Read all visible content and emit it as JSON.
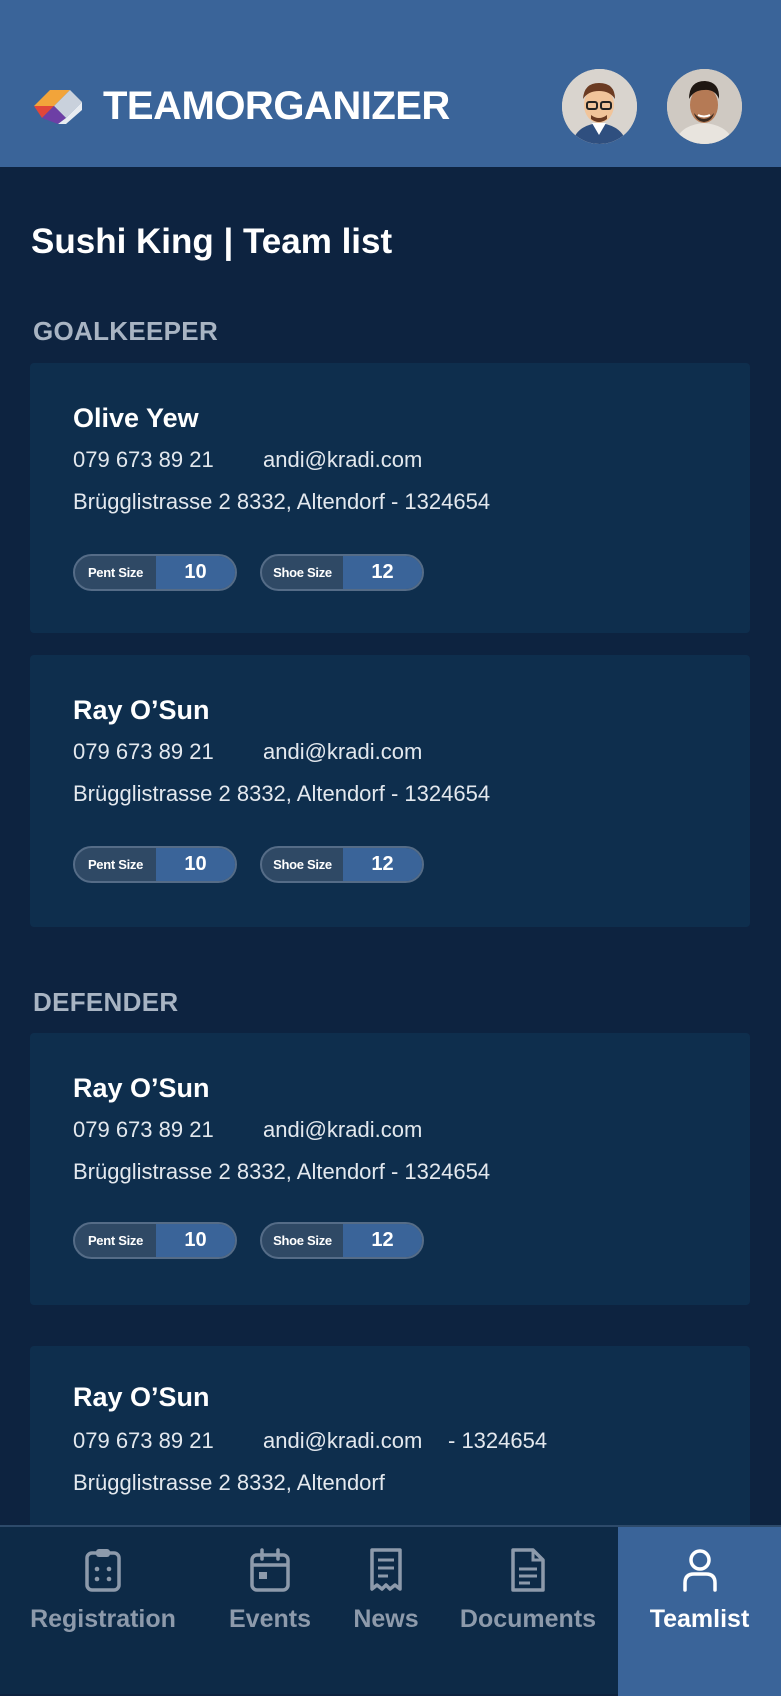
{
  "app": {
    "brand": "TEAMORGANIZER"
  },
  "page": {
    "title": "Sushi King | Team list"
  },
  "sections": [
    {
      "label": "GOALKEEPER"
    },
    {
      "label": "DEFENDER"
    }
  ],
  "players": [
    {
      "name": "Olive Yew",
      "phone": "079 673 89 21",
      "email": "andi@kradi.com",
      "address": "Brügglistrasse 2 8332, Altendorf - 1324654",
      "pant_label": "Pent Size",
      "pant_value": "10",
      "shoe_label": "Shoe Size",
      "shoe_value": "12"
    },
    {
      "name": "Ray O’Sun",
      "phone": "079 673 89 21",
      "email": "andi@kradi.com",
      "address": "Brügglistrasse 2 8332, Altendorf - 1324654",
      "pant_label": "Pent Size",
      "pant_value": "10",
      "shoe_label": "Shoe Size",
      "shoe_value": "12"
    },
    {
      "name": "Ray O’Sun",
      "phone": "079 673 89 21",
      "email": "andi@kradi.com",
      "address": "Brügglistrasse 2 8332, Altendorf - 1324654",
      "pant_label": "Pent Size",
      "pant_value": "10",
      "shoe_label": "Shoe Size",
      "shoe_value": "12"
    },
    {
      "name": "Ray O’Sun",
      "phone": "079 673 89 21",
      "email": "andi@kradi.com",
      "extra": "- 1324654",
      "address": "Brügglistrasse 2 8332, Altendorf"
    }
  ],
  "nav": [
    {
      "label": "Registration",
      "icon": "clipboard-icon"
    },
    {
      "label": "Events",
      "icon": "calendar-icon"
    },
    {
      "label": "News",
      "icon": "receipt-icon"
    },
    {
      "label": "Documents",
      "icon": "document-icon"
    },
    {
      "label": "Teamlist",
      "icon": "user-icon",
      "active": true
    }
  ],
  "colors": {
    "header": "#3a6499",
    "background": "#0d2340",
    "card": "#0e2e4d",
    "accent": "#3a6499"
  }
}
